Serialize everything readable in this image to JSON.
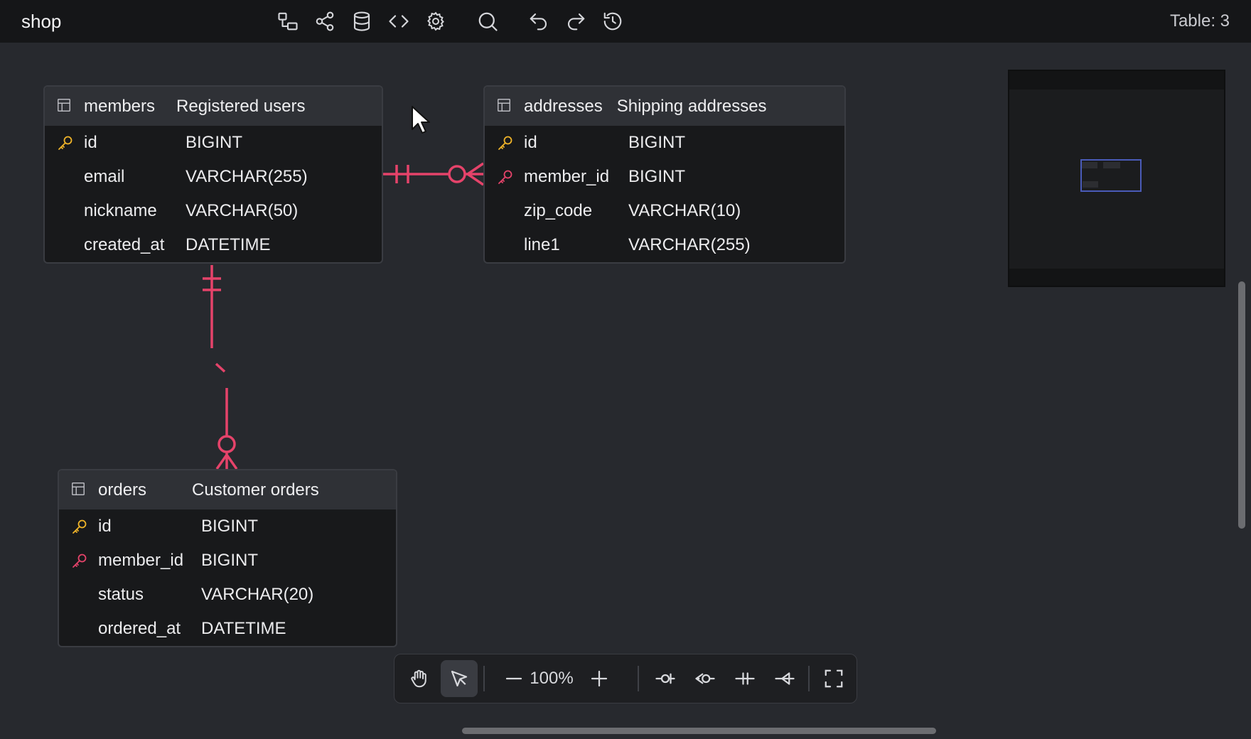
{
  "app": {
    "title": "shop",
    "table_count": "Table: 3"
  },
  "toolbar_icons": [
    "diagram-icon",
    "share-icon",
    "database-icon",
    "code-icon",
    "settings-icon",
    "search-icon",
    "undo-icon",
    "redo-icon",
    "history-icon"
  ],
  "tables": [
    {
      "name": "members",
      "comment": "Registered users",
      "columns": [
        {
          "key": "primary",
          "name": "id",
          "type": "BIGINT"
        },
        {
          "key": "",
          "name": "email",
          "type": "VARCHAR(255)"
        },
        {
          "key": "",
          "name": "nickname",
          "type": "VARCHAR(50)"
        },
        {
          "key": "",
          "name": "created_at",
          "type": "DATETIME"
        }
      ]
    },
    {
      "name": "addresses",
      "comment": "Shipping addresses",
      "columns": [
        {
          "key": "primary",
          "name": "id",
          "type": "BIGINT"
        },
        {
          "key": "foreign",
          "name": "member_id",
          "type": "BIGINT"
        },
        {
          "key": "",
          "name": "zip_code",
          "type": "VARCHAR(10)"
        },
        {
          "key": "",
          "name": "line1",
          "type": "VARCHAR(255)"
        }
      ]
    },
    {
      "name": "orders",
      "comment": "Customer orders",
      "columns": [
        {
          "key": "primary",
          "name": "id",
          "type": "BIGINT"
        },
        {
          "key": "foreign",
          "name": "member_id",
          "type": "BIGINT"
        },
        {
          "key": "",
          "name": "status",
          "type": "VARCHAR(20)"
        },
        {
          "key": "",
          "name": "ordered_at",
          "type": "DATETIME"
        }
      ]
    }
  ],
  "relationships": [
    {
      "from": "members.id",
      "to": "addresses.member_id",
      "from_cardinality": "one-and-only-one",
      "to_cardinality": "zero-or-many"
    },
    {
      "from": "members.id",
      "to": "orders.member_id",
      "from_cardinality": "one-and-only-one",
      "to_cardinality": "zero-or-many"
    }
  ],
  "bottom_toolbar": {
    "zoom": "100%",
    "tools": [
      "hand-icon",
      "pointer-icon",
      "zoom-out-icon",
      "zoom-in-icon",
      "zero-or-one-icon",
      "zero-or-many-icon",
      "one-only-icon",
      "one-or-many-icon",
      "fullscreen-icon"
    ],
    "active_tool": "pointer-icon"
  },
  "colors": {
    "background": "#27292e",
    "relation": "#e5436a",
    "primary_key": "#f0b429",
    "foreign_key": "#e5436a",
    "minimap_viewport": "#4a5bb8"
  }
}
